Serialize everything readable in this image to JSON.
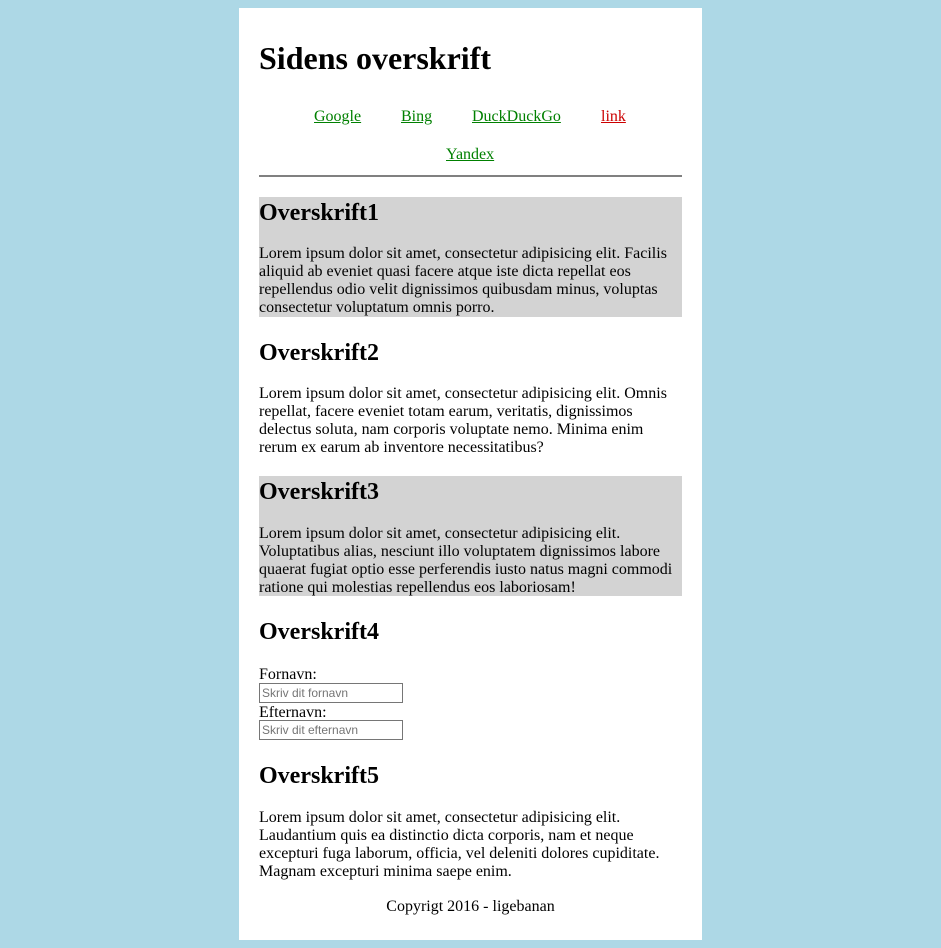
{
  "header": {
    "title": "Sidens overskrift"
  },
  "nav": {
    "links": [
      {
        "label": "Google"
      },
      {
        "label": "Bing"
      },
      {
        "label": "DuckDuckGo"
      },
      {
        "label": "link"
      },
      {
        "label": "Yandex"
      }
    ]
  },
  "sections": [
    {
      "heading": "Overskrift1",
      "text": "Lorem ipsum dolor sit amet, consectetur adipisicing elit. Facilis aliquid ab eveniet quasi facere atque iste dicta repellat eos repellendus odio velit dignissimos quibusdam minus, voluptas consectetur voluptatum omnis porro."
    },
    {
      "heading": "Overskrift2",
      "text": "Lorem ipsum dolor sit amet, consectetur adipisicing elit. Omnis repellat, facere eveniet totam earum, veritatis, dignissimos delectus soluta, nam corporis voluptate nemo. Minima enim rerum ex earum ab inventore necessitatibus?"
    },
    {
      "heading": "Overskrift3",
      "text": "Lorem ipsum dolor sit amet, consectetur adipisicing elit. Voluptatibus alias, nesciunt illo voluptatem dignissimos labore quaerat fugiat optio esse perferendis iusto natus magni commodi ratione qui molestias repellendus eos laboriosam!"
    },
    {
      "heading": "Overskrift4"
    },
    {
      "heading": "Overskrift5",
      "text": "Lorem ipsum dolor sit amet, consectetur adipisicing elit. Laudantium quis ea distinctio dicta corporis, nam et neque excepturi fuga laborum, officia, vel deleniti dolores cupiditate. Magnam excepturi minima saepe enim."
    }
  ],
  "form": {
    "first_name_label": "Fornavn:",
    "first_name_placeholder": "Skriv dit fornavn",
    "first_name_value": "",
    "last_name_label": "Efternavn:",
    "last_name_placeholder": "Skriv dit efternavn",
    "last_name_value": ""
  },
  "footer": {
    "copyright": "Copyrigt 2016 - ligebanan"
  },
  "colors": {
    "page_background": "#add8e6",
    "content_background": "#ffffff",
    "highlight_section": "#d3d3d3",
    "link_green": "#008000",
    "link_red": "#cc0000"
  }
}
